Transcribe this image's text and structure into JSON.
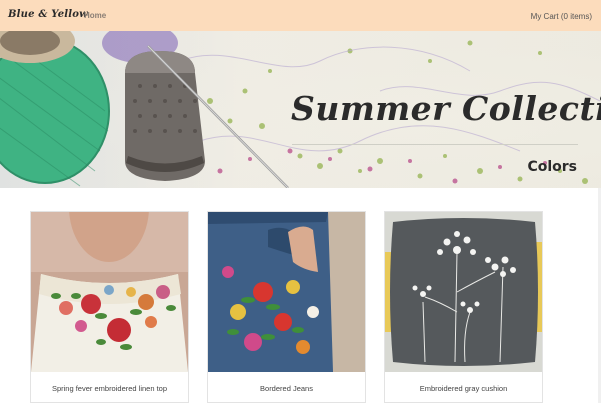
{
  "navbar": {
    "brand": "Blue & Yellow",
    "home_label": "Home",
    "cart_label": "My Cart (0 items)"
  },
  "hero": {
    "title": "Summer Collection",
    "subtitle": "Colors"
  },
  "products": [
    {
      "name": "Spring fever embroidered linen top"
    },
    {
      "name": "Bordered Jeans"
    },
    {
      "name": "Embroidered gray cushion"
    }
  ],
  "colors": {
    "navbar_bg": "#fcdcbc",
    "text_dark": "#2b2b2b"
  }
}
